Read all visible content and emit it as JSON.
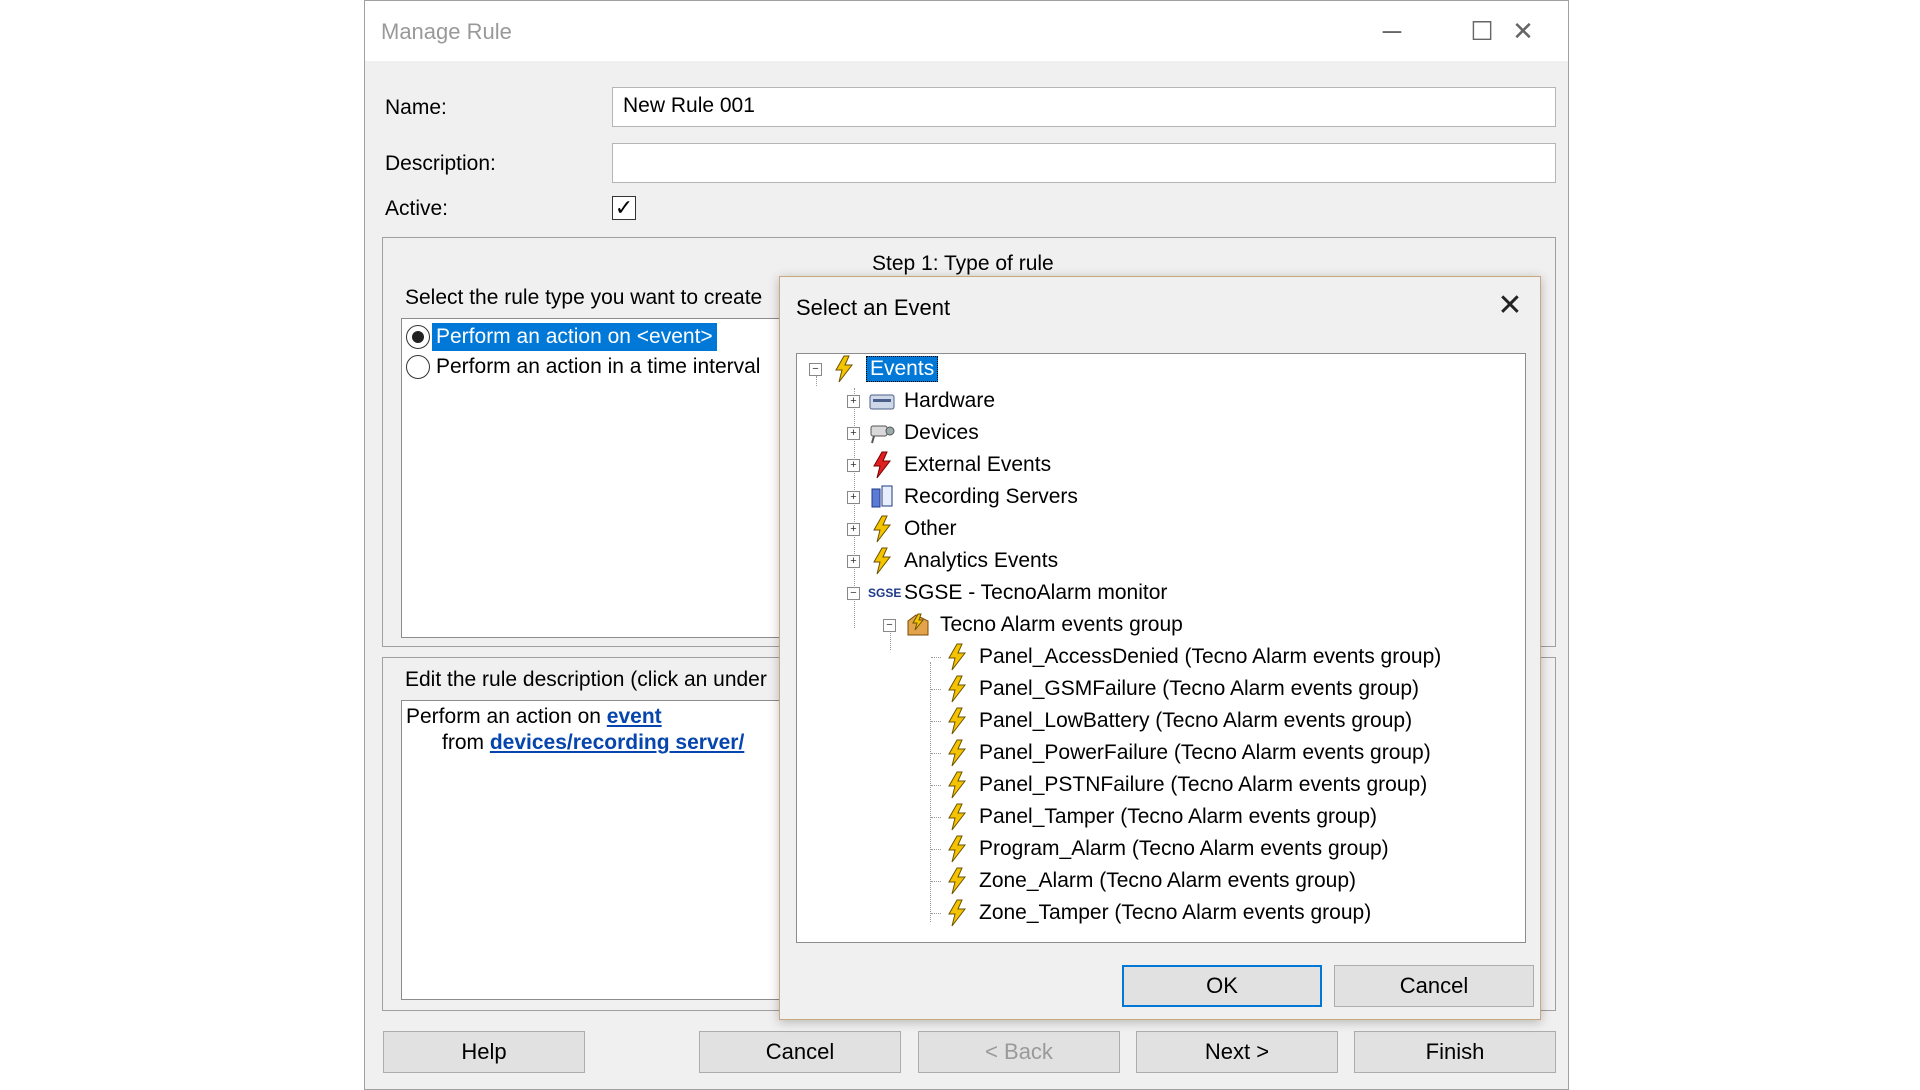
{
  "window": {
    "title": "Manage Rule",
    "controls": {
      "minimize": "─",
      "maximize": "☐",
      "close": "✕"
    }
  },
  "form": {
    "name_label": "Name:",
    "name_value": "New Rule 001",
    "description_label": "Description:",
    "description_value": "",
    "active_label": "Active:",
    "active_checked": true
  },
  "step": {
    "title": "Step 1: Type of rule",
    "select_label": "Select the rule type you want to create",
    "options": [
      {
        "label": "Perform an action on <event>",
        "selected": true
      },
      {
        "label": "Perform an action in a time interval",
        "selected": false
      }
    ],
    "edit_label": "Edit the rule description (click an under",
    "rule_text": "Perform an action on",
    "rule_link_event": "event",
    "rule_from": "from",
    "rule_link_devices": "devices/recording server/"
  },
  "bottom_buttons": {
    "help": "Help",
    "cancel": "Cancel",
    "back": "< Back",
    "next": "Next >",
    "finish": "Finish"
  },
  "dialog": {
    "title": "Select an Event",
    "close": "✕",
    "tree": {
      "root": "Events",
      "children": [
        "Hardware",
        "Devices",
        "External Events",
        "Recording Servers",
        "Other",
        "Analytics Events"
      ],
      "sgse_badge": "SGSE",
      "sgse": "SGSE - TecnoAlarm monitor",
      "group": "Tecno Alarm events group",
      "events": [
        "Panel_AccessDenied (Tecno Alarm events group)",
        "Panel_GSMFailure (Tecno Alarm events group)",
        "Panel_LowBattery (Tecno Alarm events group)",
        "Panel_PowerFailure (Tecno Alarm events group)",
        "Panel_PSTNFailure (Tecno Alarm events group)",
        "Panel_Tamper (Tecno Alarm events group)",
        "Program_Alarm (Tecno Alarm events group)",
        "Zone_Alarm (Tecno Alarm events group)",
        "Zone_Tamper (Tecno Alarm events group)"
      ]
    },
    "ok": "OK",
    "cancel": "Cancel"
  },
  "colors": {
    "selection": "#0078d7",
    "link": "#0645ad",
    "bolt": "#f5c400"
  }
}
